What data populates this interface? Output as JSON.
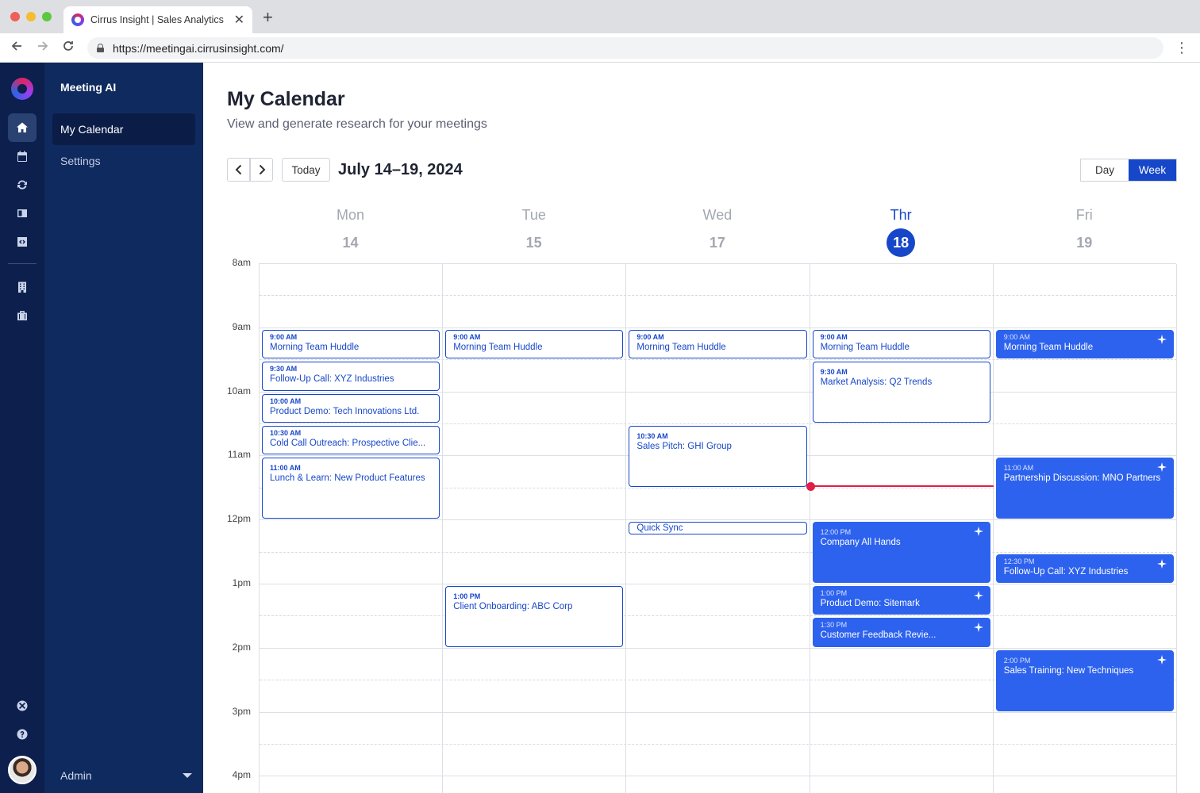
{
  "browser": {
    "tab_title": "Cirrus Insight | Sales Analytics",
    "url": "https://meetingai.cirrusinsight.com/"
  },
  "sidebar": {
    "app_name": "Meeting AI",
    "items": [
      {
        "label": "My Calendar",
        "active": true
      },
      {
        "label": "Settings",
        "active": false
      }
    ],
    "user_label": "Admin"
  },
  "rail": {
    "icons": [
      "home-icon",
      "calendar-icon",
      "sync-icon",
      "book-icon",
      "code-icon",
      "building-icon",
      "briefcase-icon",
      "xray-icon",
      "help-icon"
    ]
  },
  "header": {
    "title": "My Calendar",
    "subtitle": "View and generate research for your meetings"
  },
  "toolbar": {
    "today_label": "Today",
    "date_range": "July 14–19, 2024",
    "views": [
      "Day",
      "Week"
    ],
    "active_view": "Week"
  },
  "days": [
    {
      "name": "Mon",
      "num": "14",
      "today": false
    },
    {
      "name": "Tue",
      "num": "15",
      "today": false
    },
    {
      "name": "Wed",
      "num": "17",
      "today": false
    },
    {
      "name": "Thr",
      "num": "18",
      "today": true
    },
    {
      "name": "Fri",
      "num": "19",
      "today": false
    }
  ],
  "hours": [
    "8am",
    "9am",
    "10am",
    "11am",
    "12pm",
    "1pm",
    "2pm",
    "3pm",
    "4pm"
  ],
  "events": [
    {
      "day": 0,
      "start": 9.0,
      "end": 9.5,
      "time": "9:00 AM",
      "title": "Morning Team Huddle",
      "style": "outline"
    },
    {
      "day": 0,
      "start": 9.5,
      "end": 10.0,
      "time": "9:30 AM",
      "title": "Follow-Up Call: XYZ Industries",
      "style": "outline"
    },
    {
      "day": 0,
      "start": 10.0,
      "end": 10.5,
      "time": "10:00 AM",
      "title": "Product Demo: Tech Innovations Ltd.",
      "style": "outline"
    },
    {
      "day": 0,
      "start": 10.5,
      "end": 11.0,
      "time": "10:30 AM",
      "title": "Cold Call Outreach: Prospective Clie...",
      "style": "outline"
    },
    {
      "day": 0,
      "start": 11.0,
      "end": 12.0,
      "time": "11:00 AM",
      "title": "Lunch & Learn: New Product Features",
      "style": "outline"
    },
    {
      "day": 1,
      "start": 9.0,
      "end": 9.5,
      "time": "9:00 AM",
      "title": "Morning Team Huddle",
      "style": "outline"
    },
    {
      "day": 1,
      "start": 13.0,
      "end": 14.0,
      "time": "1:00 PM",
      "title": "Client Onboarding: ABC Corp",
      "style": "outline"
    },
    {
      "day": 2,
      "start": 9.0,
      "end": 9.5,
      "time": "9:00 AM",
      "title": "Morning Team Huddle",
      "style": "outline"
    },
    {
      "day": 2,
      "start": 10.5,
      "end": 11.5,
      "time": "10:30 AM",
      "title": "Sales Pitch: GHI Group",
      "style": "outline"
    },
    {
      "day": 2,
      "start": 12.0,
      "end": 12.25,
      "time": "",
      "title": "Quick Sync",
      "style": "outline"
    },
    {
      "day": 3,
      "start": 9.0,
      "end": 9.5,
      "time": "9:00 AM",
      "title": "Morning Team Huddle",
      "style": "outline"
    },
    {
      "day": 3,
      "start": 9.5,
      "end": 10.5,
      "time": "9:30 AM",
      "title": "Market Analysis: Q2 Trends",
      "style": "outline"
    },
    {
      "day": 3,
      "start": 12.0,
      "end": 13.0,
      "time": "12:00 PM",
      "title": "Company All Hands",
      "style": "filled",
      "sparkle": true
    },
    {
      "day": 3,
      "start": 13.0,
      "end": 13.5,
      "time": "1:00 PM",
      "title": "Product Demo: Sitemark",
      "style": "filled",
      "sparkle": true
    },
    {
      "day": 3,
      "start": 13.5,
      "end": 14.0,
      "time": "1:30 PM",
      "title": "Customer Feedback Revie...",
      "style": "filled",
      "sparkle": true
    },
    {
      "day": 4,
      "start": 9.0,
      "end": 9.5,
      "time": "9:00 AM",
      "title": "Morning Team Huddle",
      "style": "filled",
      "sparkle": true
    },
    {
      "day": 4,
      "start": 11.0,
      "end": 12.0,
      "time": "11:00 AM",
      "title": "Partnership Discussion: MNO Partners",
      "style": "filled",
      "sparkle": true
    },
    {
      "day": 4,
      "start": 12.5,
      "end": 13.0,
      "time": "12:30 PM",
      "title": "Follow-Up Call: XYZ Industries",
      "style": "filled",
      "sparkle": true
    },
    {
      "day": 4,
      "start": 14.0,
      "end": 15.0,
      "time": "2:00 PM",
      "title": "Sales Training: New Techniques",
      "style": "filled",
      "sparkle": true
    }
  ],
  "now": {
    "day": 3,
    "time": 11.47
  },
  "colors": {
    "primary": "#1747c9",
    "event_fill": "#2d62ee",
    "now_line": "#e11d48",
    "rail_bg": "#0c1f4d",
    "sidebar_bg": "#0f2a5e"
  }
}
